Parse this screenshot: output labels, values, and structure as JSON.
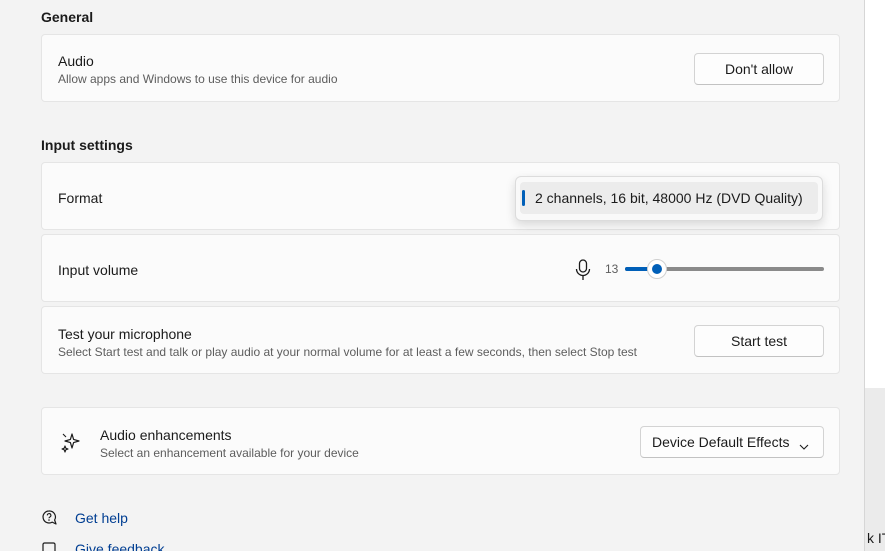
{
  "general": {
    "title": "General",
    "audio": {
      "title": "Audio",
      "description": "Allow apps and Windows to use this device for audio",
      "button_label": "Don't allow"
    }
  },
  "input_settings": {
    "title": "Input settings",
    "format": {
      "title": "Format",
      "selected_option": "2 channels, 16 bit, 48000 Hz (DVD Quality)"
    },
    "input_volume": {
      "title": "Input volume",
      "value": "13",
      "level_percent": 13
    },
    "test_microphone": {
      "title": "Test your microphone",
      "description": "Select Start test and talk or play audio at your normal volume for at least a few seconds, then select Stop test",
      "button_label": "Start test"
    }
  },
  "enhancements": {
    "title": "Audio enhancements",
    "description": "Select an enhancement available for your device",
    "dropdown_value": "Device Default Effects"
  },
  "links": {
    "get_help": "Get help",
    "give_feedback": "Give feedback"
  },
  "side_peek_text": "k IT",
  "colors": {
    "accent": "#005fb8",
    "link": "#003e92",
    "background": "#f3f3f3",
    "card": "#fbfbfb"
  }
}
